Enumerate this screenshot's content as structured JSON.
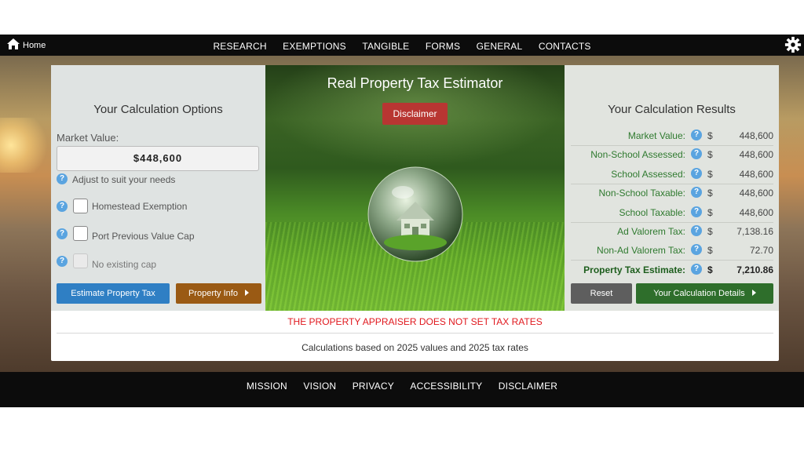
{
  "topbar": {
    "home_label": "Home",
    "nav": [
      "RESEARCH",
      "EXEMPTIONS",
      "TANGIBLE",
      "FORMS",
      "GENERAL",
      "CONTACTS"
    ]
  },
  "left": {
    "title": "Your Calculation Options",
    "market_value_label": "Market Value:",
    "market_value": "$448,600",
    "adjust_hint": "Adjust to suit your needs",
    "homestead_label": "Homestead Exemption",
    "port_label": "Port Previous Value Cap",
    "no_cap_label": "No existing cap",
    "estimate_button": "Estimate Property Tax",
    "info_button": "Property Info"
  },
  "center": {
    "title": "Real Property Tax Estimator",
    "disclaimer_button": "Disclaimer"
  },
  "right": {
    "title": "Your Calculation Results",
    "rows": [
      {
        "label": "Market Value:",
        "currency": "$",
        "value": "448,600"
      },
      {
        "label": "Non-School Assessed:",
        "currency": "$",
        "value": "448,600"
      },
      {
        "label": "School Assessed:",
        "currency": "$",
        "value": "448,600"
      },
      {
        "label": "Non-School Taxable:",
        "currency": "$",
        "value": "448,600"
      },
      {
        "label": "School Taxable:",
        "currency": "$",
        "value": "448,600"
      },
      {
        "label": "Ad Valorem Tax:",
        "currency": "$",
        "value": "7,138.16"
      },
      {
        "label": "Non-Ad Valorem Tax:",
        "currency": "$",
        "value": "72.70"
      },
      {
        "label": "Property Tax Estimate:",
        "currency": "$",
        "value": "7,210.86"
      }
    ],
    "reset_button": "Reset",
    "details_button": "Your Calculation Details"
  },
  "notice": "THE PROPERTY APPRAISER DOES NOT SET TAX RATES",
  "basis": "Calculations based on 2025 values and 2025 tax rates",
  "footer": {
    "nav": [
      "MISSION",
      "VISION",
      "PRIVACY",
      "ACCESSIBILITY",
      "DISCLAIMER"
    ]
  },
  "colors": {
    "accent_blue": "#2f7fc4",
    "brown_button": "#9a5a14",
    "disclaimer_red": "#b83632",
    "reset_gray": "#5e5e5e",
    "details_green": "#2e6e2b",
    "notice_red": "#e0181e",
    "result_green": "#2f7a2f"
  },
  "icons": [
    "home-icon",
    "gear-icon",
    "help-icon",
    "caret-right-icon"
  ]
}
